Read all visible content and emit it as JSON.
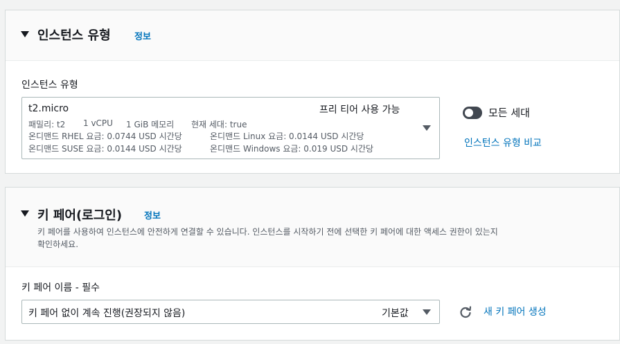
{
  "instance_type_section": {
    "title": "인스턴스 유형",
    "info_link": "정보",
    "field_label": "인스턴스 유형",
    "selected": {
      "name": "t2.micro",
      "free_tier": "프리 티어 사용 가능",
      "family": "패밀리: t2",
      "vcpu": "1 vCPU",
      "memory": "1 GiB 메모리",
      "current_gen": "현재 세대: true",
      "rhel_price": "온디맨드 RHEL 요금: 0.0744 USD 시간당",
      "linux_price": "온디맨드 Linux 요금: 0.0144 USD 시간당",
      "suse_price": "온디맨드 SUSE 요금: 0.0144 USD 시간당",
      "windows_price": "온디맨드 Windows 요금: 0.019 USD 시간당"
    },
    "toggle_label": "모든 세대",
    "toggle_on": false,
    "compare_link": "인스턴스 유형 비교"
  },
  "key_pair_section": {
    "title": "키 페어(로그인)",
    "info_link": "정보",
    "description_line1": "키 페어를 사용하여 인스턴스에 안전하게 연결할 수 있습니다. 인스턴스를 시작하기 전에 선택한 키 페어에 대한 액세스 권한이 있는지",
    "description_line2": "확인하세요.",
    "field_label": "키 페어 이름 - 필수",
    "selected_value": "키 페어 없이 계속 진행(권장되지 않음)",
    "default_badge": "기본값",
    "refresh_icon": "refresh-icon",
    "create_link": "새 키 페어 생성"
  },
  "colors": {
    "link": "#0073bb",
    "text": "#16191f",
    "secondary_text": "#545b64",
    "background": "#f2f3f3",
    "panel_header": "#fafafa",
    "toggle_off": "#414750"
  }
}
